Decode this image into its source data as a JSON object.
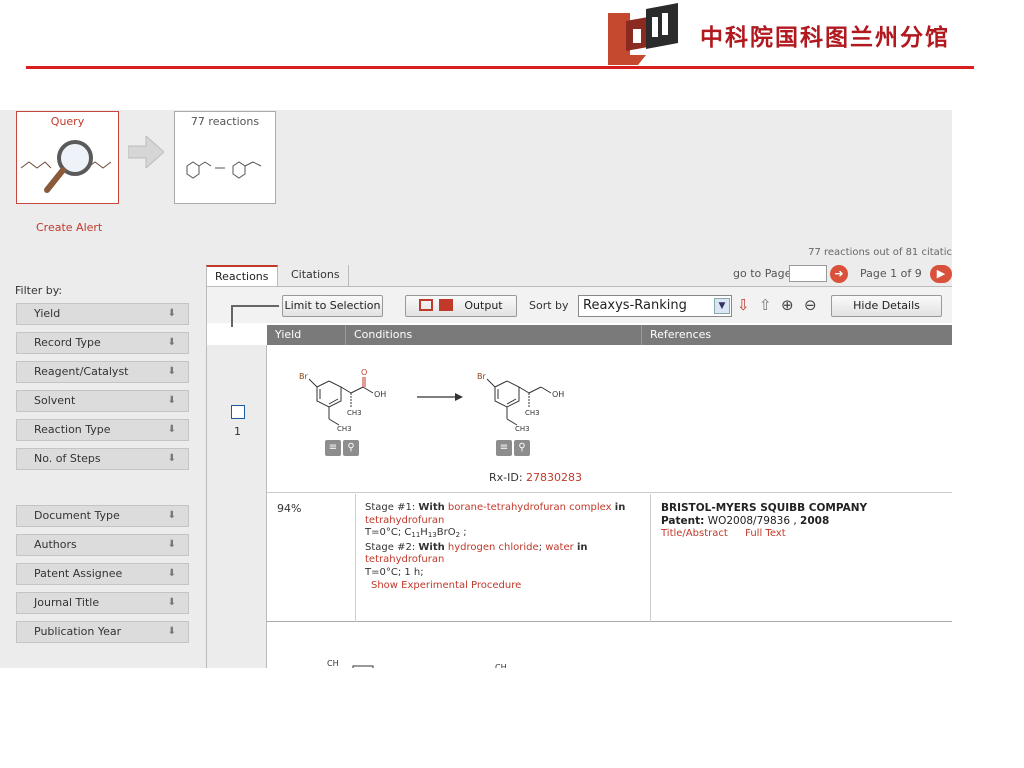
{
  "banner": {
    "title": "中科院国科图兰州分馆",
    "logo_icon": "library-logo-icon",
    "accent_color": "#d81e1e"
  },
  "query": {
    "label": "Query",
    "result_label": "77 reactions",
    "create_alert": "Create Alert",
    "count_text": "77 reactions out of 81 citatic"
  },
  "filters": {
    "title": "Filter by:",
    "group1": [
      "Yield",
      "Record Type",
      "Reagent/Catalyst",
      "Solvent",
      "Reaction Type",
      "No. of Steps"
    ],
    "group2": [
      "Document Type",
      "Authors",
      "Patent Assignee",
      "Journal Title",
      "Publication Year"
    ]
  },
  "tabs": {
    "reactions": "Reactions",
    "citations": "Citations"
  },
  "pagination": {
    "goto_label": "go to Page",
    "page_info": "Page 1 of 9"
  },
  "toolbar": {
    "limit": "Limit to Selection",
    "output": "Output",
    "sort_label": "Sort by",
    "sort_value": "Reaxys-Ranking",
    "hide_details": "Hide Details"
  },
  "columns": {
    "yield": "Yield",
    "conditions": "Conditions",
    "references": "References"
  },
  "results": [
    {
      "num": "1",
      "rx_prefix": "Rx-ID:",
      "rx_id": "27830283",
      "yield": "94%",
      "stage1_prefix": "Stage #1:",
      "with": "With",
      "in": "in",
      "stage1_reagent": "borane-tetrahydrofuran complex",
      "stage1_solvent": "tetrahydrofuran",
      "stage1_cond": "T=0°C;",
      "formula": {
        "c": "C",
        "c_n": "11",
        "h": "H",
        "h_n": "13",
        "br": "BrO",
        "o_n": "2",
        "end": ";"
      },
      "stage2_prefix": "Stage #2:",
      "stage2_reagent_a": "hydrogen chloride",
      "sep": ";",
      "stage2_reagent_b": "water",
      "stage2_solvent": "tetrahydrofuran",
      "stage2_cond": "T=0°C; 1 h;",
      "procedure_link": "Show Experimental Procedure",
      "ref_company": "BRISTOL-MYERS SQUIBB COMPANY",
      "ref_patent_label": "Patent:",
      "ref_patent_num": "WO2008/79836",
      "ref_year_sep": ",",
      "ref_year": "2008",
      "ref_title_link": "Title/Abstract",
      "ref_fulltext_link": "Full Text"
    }
  ],
  "next_row": {
    "partial_label_a": "CH",
    "partial_label_b": "CH"
  }
}
